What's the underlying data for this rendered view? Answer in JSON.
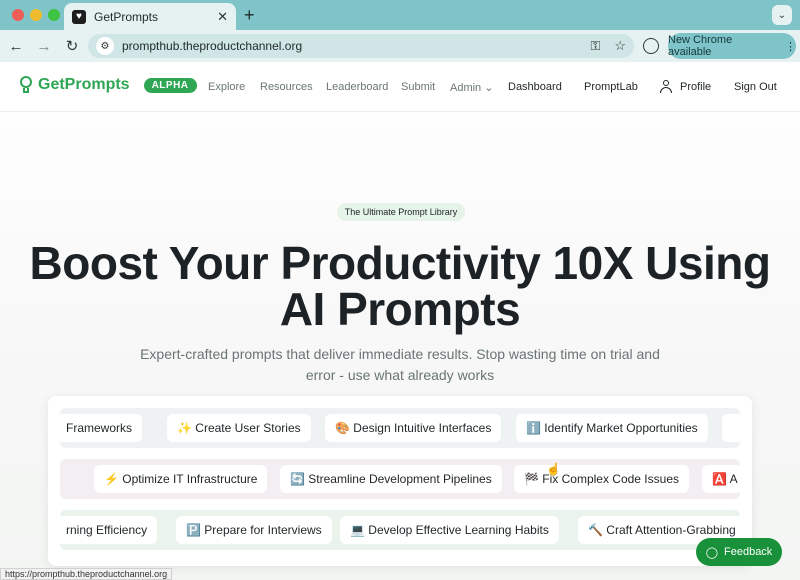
{
  "browser": {
    "tab_title": "GetPrompts",
    "tab_close": "✕",
    "new_tab": "+",
    "tab_menu": "⌄",
    "back": "←",
    "forward": "→",
    "reload": "↻",
    "url": "prompthub.theproductchannel.org",
    "update_label": "New Chrome available",
    "update_more": "⋮",
    "status_url": "https://prompthub.theproductchannel.org"
  },
  "nav": {
    "brand": "GetPrompts",
    "badge": "ALPHA",
    "links": [
      "Explore",
      "Resources",
      "Leaderboard",
      "Submit"
    ],
    "admin": "Admin",
    "dashboard": "Dashboard",
    "promptlab": "PromptLab",
    "profile": "Profile",
    "signout": "Sign Out"
  },
  "hero": {
    "pill": "The Ultimate Prompt Library",
    "headline_line1": "Boost Your Productivity 10X Using",
    "headline_line2": "AI Prompts",
    "sub_line1": "Expert-crafted prompts that deliver immediate results. Stop wasting time on trial and",
    "sub_line2": "error - use what already works"
  },
  "marquee": {
    "row1": [
      "Frameworks",
      "✨ Create User Stories",
      "🎨 Design Intuitive Interfaces",
      "ℹ️ Identify Market Opportunities"
    ],
    "row2": [
      "⚡ Optimize IT Infrastructure",
      "🔄 Streamline Development Pipelines",
      "🏁 Fix Complex Code Issues",
      "🅰️ A"
    ],
    "row3": [
      "rning Efficiency",
      "🅿️ Prepare for Interviews",
      "💻 Develop Effective Learning Habits",
      "🔨 Craft Attention-Grabbing I"
    ]
  },
  "feedback": "Feedback",
  "colors": {
    "brand_green": "#2ea653",
    "feedback_green": "#19913a",
    "chrome_teal": "#7ec4c8"
  }
}
